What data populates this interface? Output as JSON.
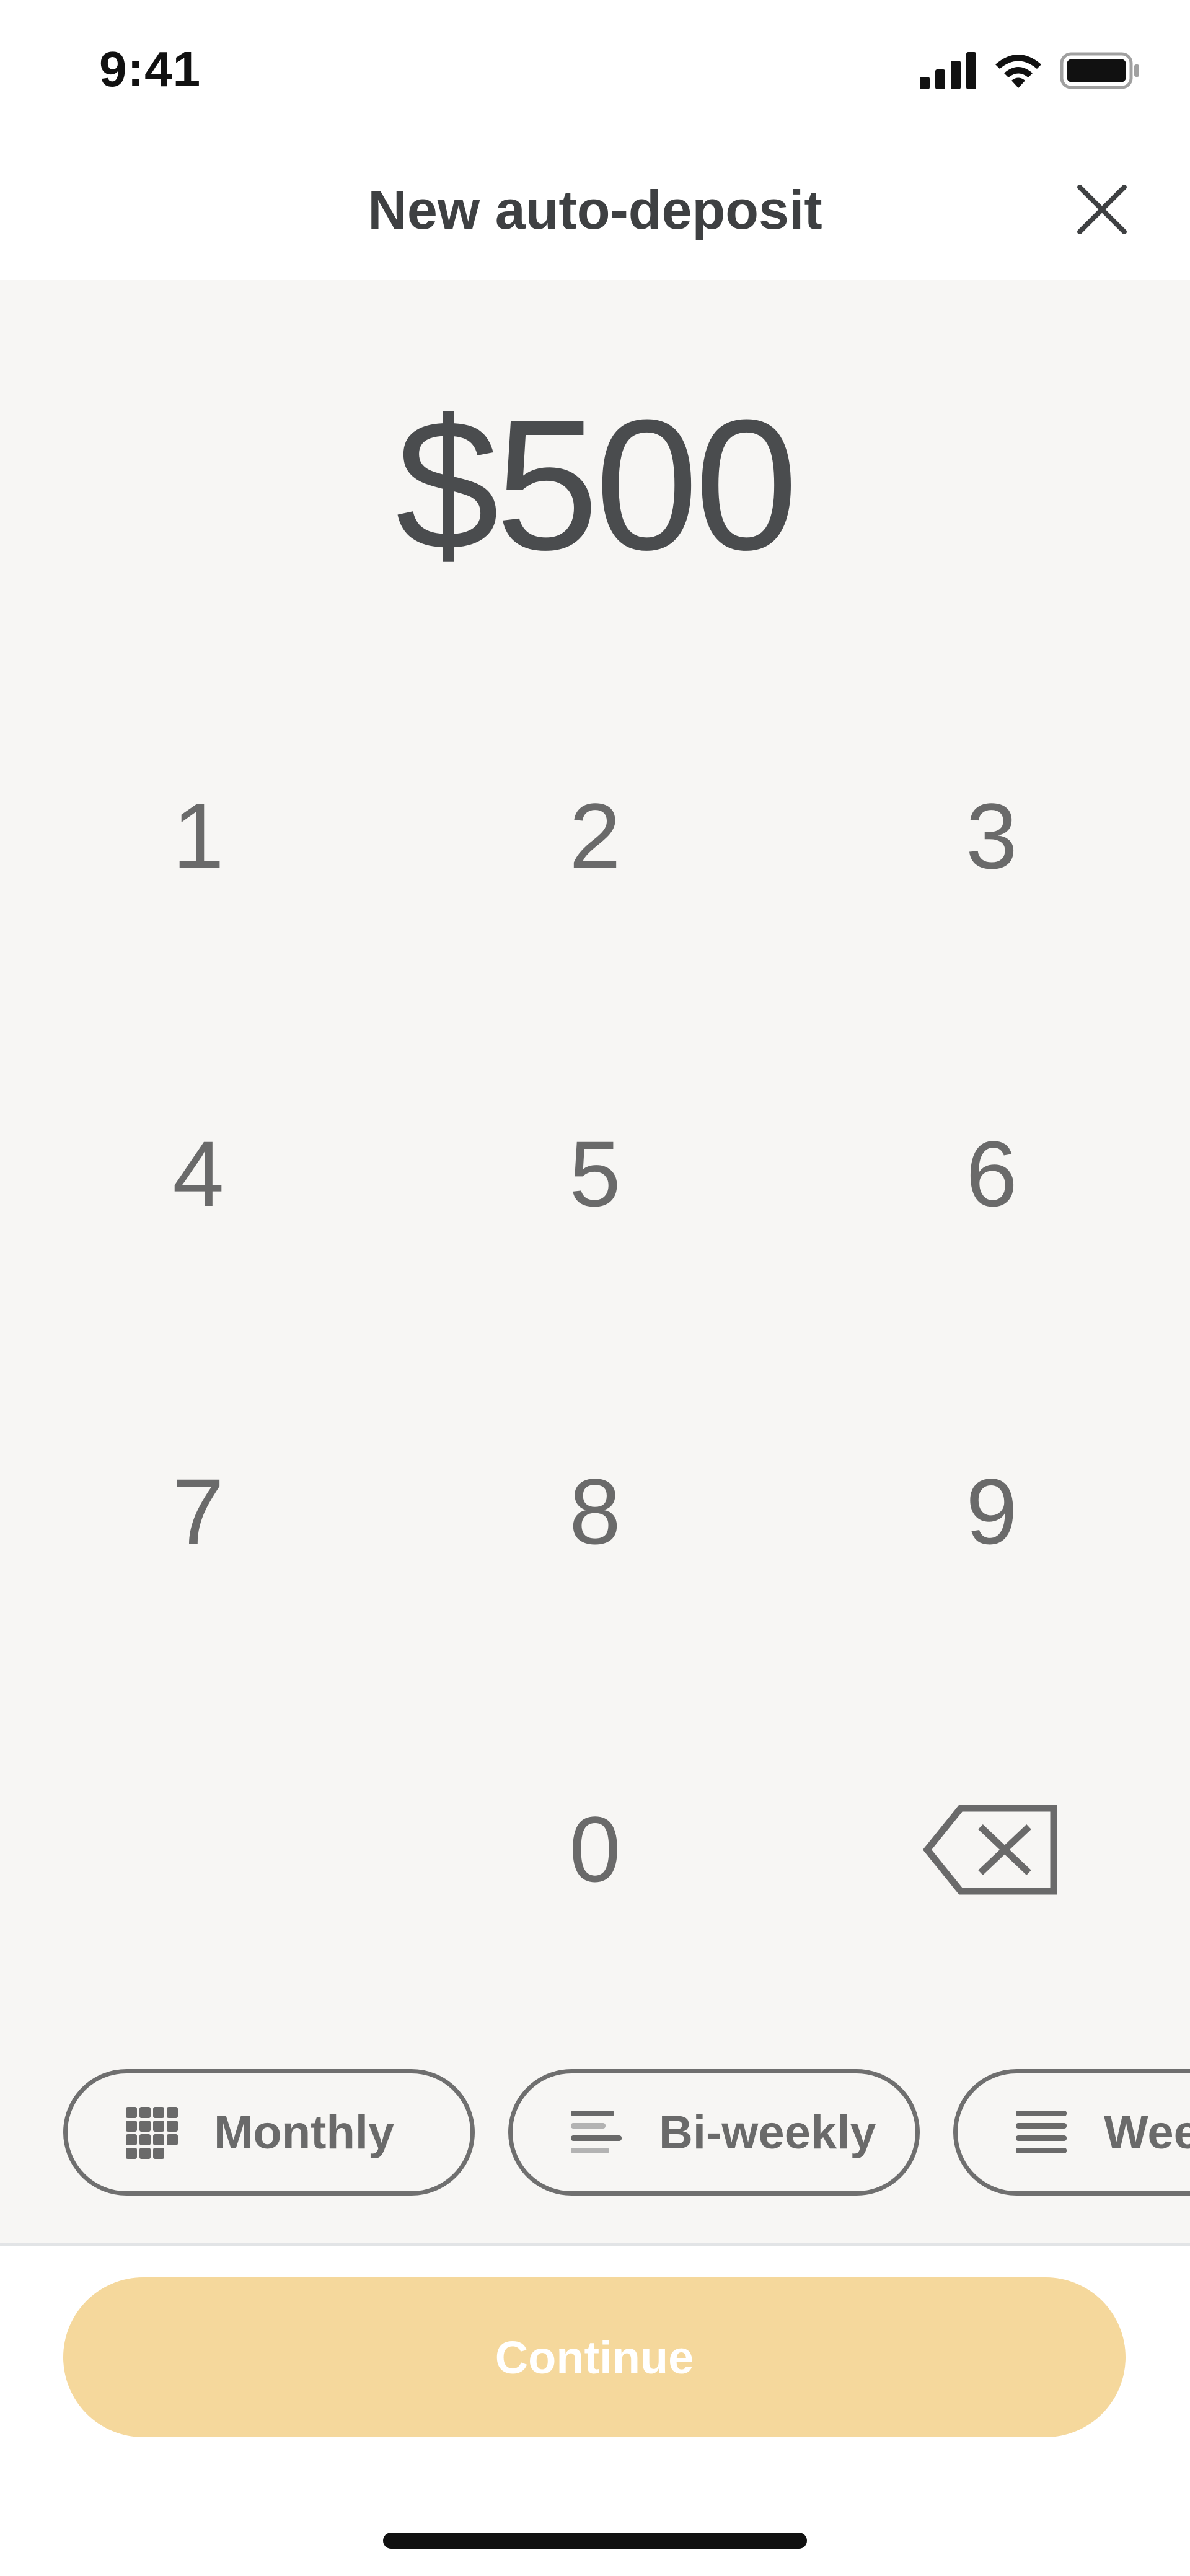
{
  "status_bar": {
    "time": "9:41",
    "icons": [
      "signal-icon",
      "wifi-icon",
      "battery-icon"
    ]
  },
  "header": {
    "title": "New auto-deposit",
    "close_icon": "close-icon"
  },
  "amount": {
    "display": "$500"
  },
  "keypad": {
    "keys": [
      "1",
      "2",
      "3",
      "4",
      "5",
      "6",
      "7",
      "8",
      "9",
      "0"
    ],
    "backspace_icon": "backspace-icon"
  },
  "frequency_chips": [
    {
      "label": "Monthly",
      "icon": "grid-icon"
    },
    {
      "label": "Bi-weekly",
      "icon": "lines-icon"
    },
    {
      "label": "Weekly",
      "icon": "list-icon"
    }
  ],
  "continue_button": {
    "label": "Continue"
  },
  "colors": {
    "background": "#f7f6f4",
    "text": "#4a4c4e",
    "key_text": "#6a6a6a",
    "continue_bg": "#f5d89c",
    "continue_text": "#ffffff"
  }
}
